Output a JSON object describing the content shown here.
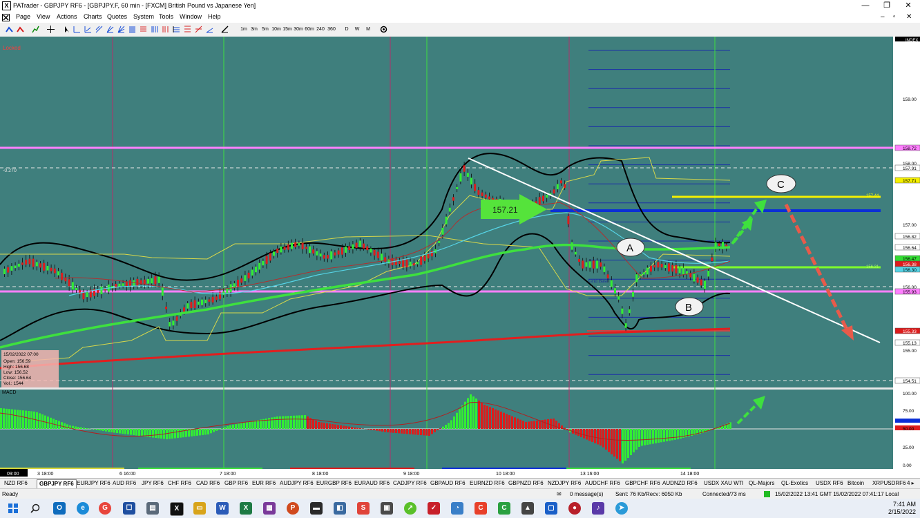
{
  "window": {
    "title": "PATrader - GBPJPY RF6 - [GBPJPY.F, 60 min - [FXCM] British Pound vs Japanese Yen]",
    "controls": [
      "—",
      "❐",
      "✕"
    ]
  },
  "menu": [
    "Page",
    "View",
    "Actions",
    "Charts",
    "Quotes",
    "System",
    "Tools",
    "Window",
    "Help"
  ],
  "timeframes": [
    "1m",
    "3m",
    "5m",
    "10m",
    "15m",
    "30m",
    "60m",
    "240",
    "360",
    "D",
    "W",
    "M"
  ],
  "chart": {
    "locked_label": "Locked",
    "index_label": "INDEX",
    "fib_label": "-0.270",
    "grid_base_label": "Grid Base",
    "price_callout": "157.21",
    "wave_labels": {
      "a": "A",
      "b": "B",
      "c": "C"
    },
    "yellow_level_label": "157.44",
    "green_level_label": "156.31",
    "macd_label": "MACD",
    "info_box": {
      "date": "15/02/2022 07:00",
      "open": "Open: 156.59",
      "high": "High: 156.68",
      "low": "Low: 156.52",
      "close": "Close: 156.64",
      "vol": "Vol.: 1544"
    },
    "price_axis": [
      {
        "label": "159.00",
        "style": "plain"
      },
      {
        "label": "158.72",
        "style": "pink"
      },
      {
        "label": "158.00",
        "style": "plain"
      },
      {
        "label": "157.91",
        "style": "white"
      },
      {
        "label": "157.71",
        "style": "yellow"
      },
      {
        "label": "157.00",
        "style": "plain"
      },
      {
        "label": "156.82",
        "style": "white"
      },
      {
        "label": "156.64",
        "style": "white"
      },
      {
        "label": "156.47",
        "style": "green"
      },
      {
        "label": "156.38",
        "style": "red"
      },
      {
        "label": "156.30",
        "style": "cyan"
      },
      {
        "label": "156.00",
        "style": "plain"
      },
      {
        "label": "155.93",
        "style": "pink"
      },
      {
        "label": "155.33",
        "style": "red"
      },
      {
        "label": "155.13",
        "style": "white"
      },
      {
        "label": "155.00",
        "style": "plain"
      },
      {
        "label": "154.51",
        "style": "white"
      }
    ],
    "macd_axis": [
      "100.00",
      "75.00",
      "50.00",
      "25.00",
      "0.00"
    ],
    "time_axis": [
      "09:00",
      "3 18:00",
      "6 16:00",
      "7 18:00",
      "8 18:00",
      "9 18:00",
      "10 18:00",
      "13 16:00",
      "14 18:00"
    ],
    "colors": {
      "background": "#3f7f7d",
      "bull": "#33ee33",
      "bear": "#dd1c1c",
      "pink": "#ff80ff",
      "yellow": "#f5f000",
      "blue": "#0b2fd6"
    }
  },
  "symbol_tabs": [
    "NZD RF6",
    "GBPJPY RF6",
    "EURJPY RF6",
    "AUD RF6",
    "JPY RF6",
    "CHF RF6",
    "CAD RF6",
    "GBP RF6",
    "EUR RF6",
    "AUDJPY RF6",
    "EURGBP RF6",
    "EURAUD RF6",
    "CADJPY RF6",
    "GBPAUD RF6",
    "EURNZD RF6",
    "GBPNZD RF6",
    "NZDJPY RF6",
    "AUDCHF RF6",
    "GBPCHF RF6",
    "AUDNZD RF6",
    "USDX XAU WTI",
    "QL-Majors",
    "QL-Exotics",
    "USDX RF6",
    "Bitcoin",
    "XRPUSDRF6"
  ],
  "active_tab": "GBPJPY RF6",
  "status": {
    "ready": "Ready",
    "messages": "0 message(s)",
    "traffic": "Sent: 76 Kb/Recv: 6050 Kb",
    "connected": "Connected/73 ms",
    "time": "15/02/2022 13:41 GMT  15/02/2022 07:41:17 Local"
  },
  "taskbar": {
    "clock_time": "7:41 AM",
    "clock_date": "2/15/2022"
  }
}
